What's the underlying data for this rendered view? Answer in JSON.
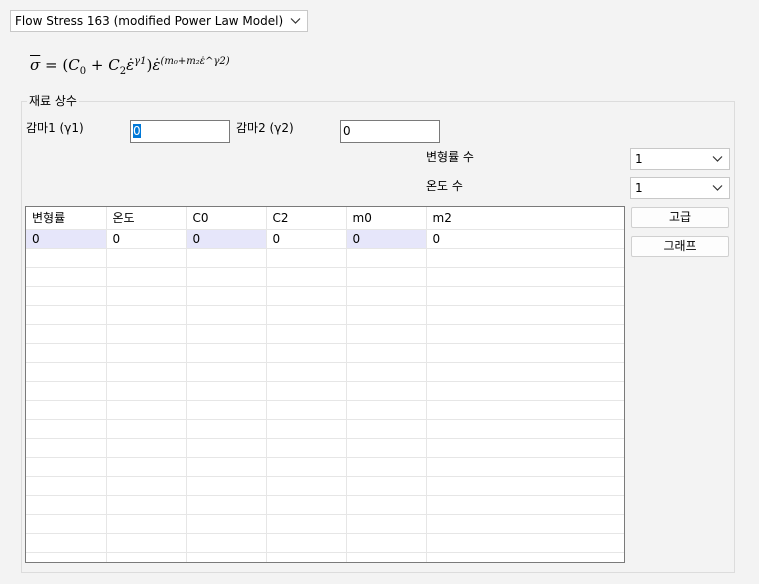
{
  "model_select": {
    "value": "Flow Stress 163 (modified Power Law Model)"
  },
  "formula": {
    "lhs": "σ",
    "eq": "=",
    "open": "(",
    "c0": "C",
    "c0_sub": "0",
    "plus": "+",
    "c2": "C",
    "c2_sub": "2",
    "strain_rate": "ε̇",
    "gamma1": "γ1",
    "close": ")",
    "exponent": "(m₀+m₂ε̇^γ2)"
  },
  "group": {
    "title": "재료 상수"
  },
  "gamma1": {
    "label": "감마1 (γ1)",
    "value": "0"
  },
  "gamma2": {
    "label": "감마2 (γ2)",
    "value": "0"
  },
  "strain_rate_count": {
    "label": "변형률 수",
    "value": "1"
  },
  "temperature_count": {
    "label": "온도 수",
    "value": "1"
  },
  "buttons": {
    "advanced": "고급",
    "graph": "그래프"
  },
  "table": {
    "columns": [
      "변형률",
      "온도",
      "C0",
      "C2",
      "m0",
      "m2"
    ],
    "rows": [
      [
        "0",
        "0",
        "0",
        "0",
        "0",
        "0"
      ]
    ]
  }
}
